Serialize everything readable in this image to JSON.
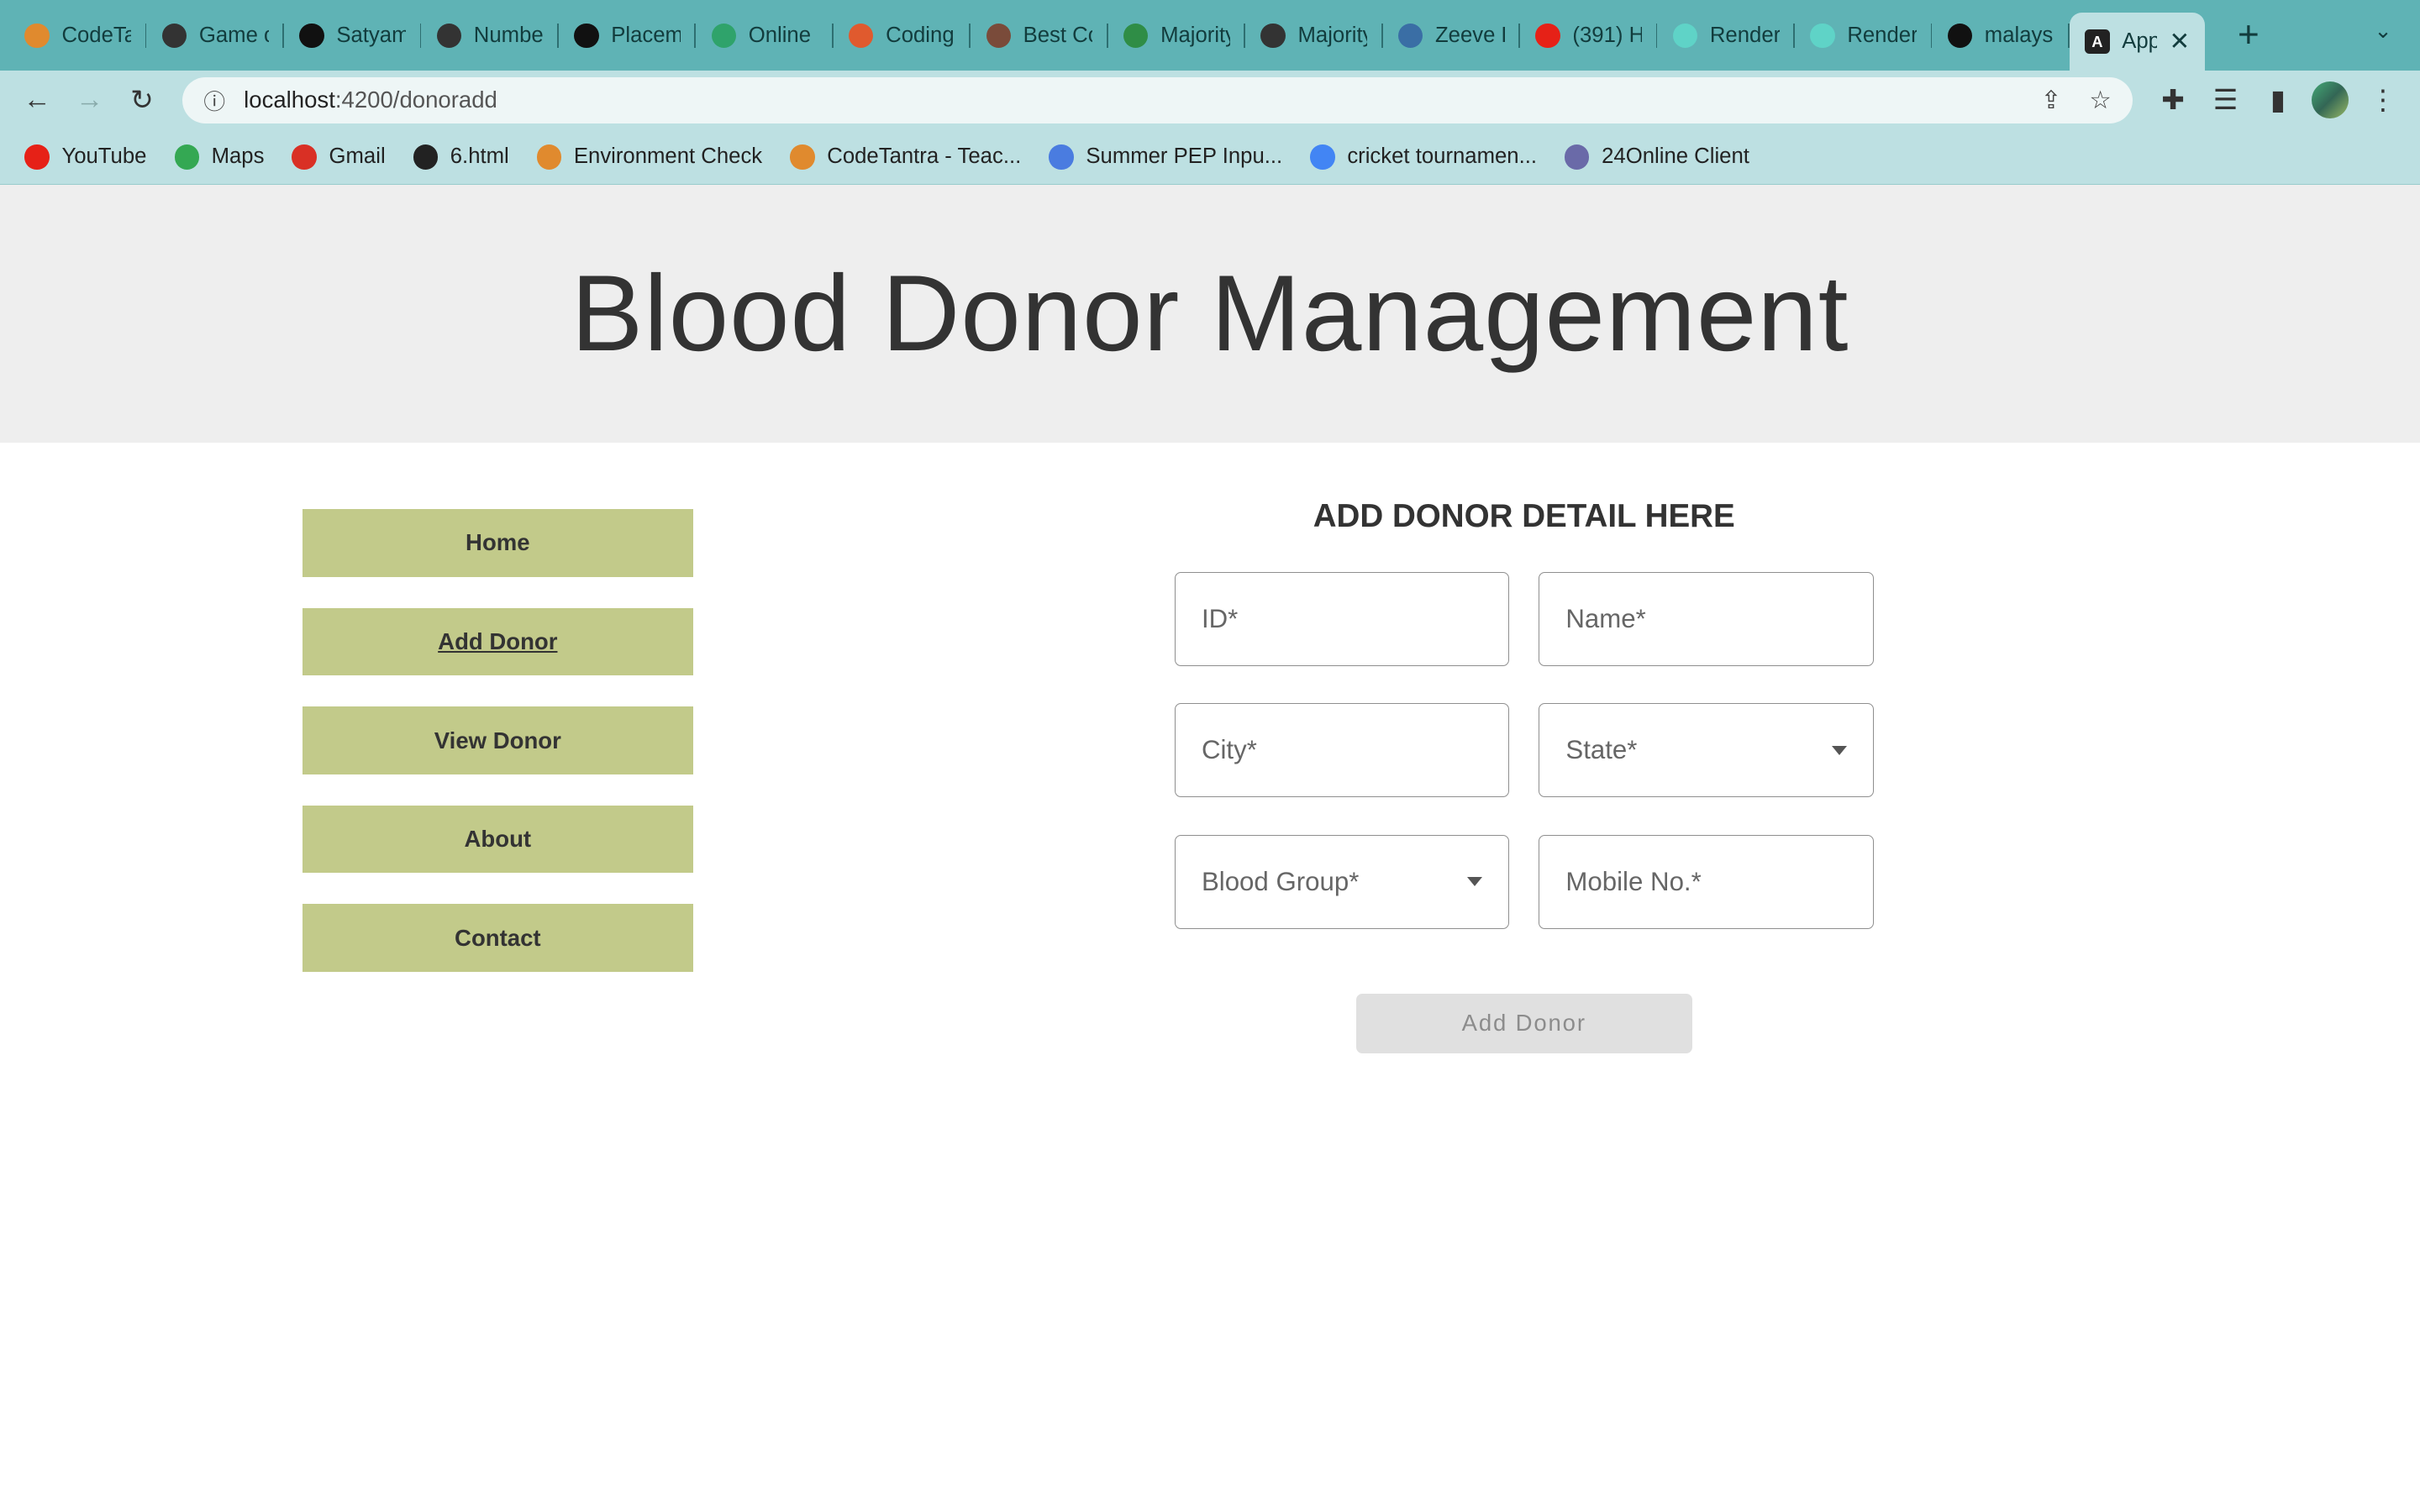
{
  "browser": {
    "tabs": [
      {
        "label": "CodeTa",
        "icon": "codetantra-icon",
        "color": "#e08a2e"
      },
      {
        "label": "Game o",
        "icon": "geeks-icon",
        "color": "#333333"
      },
      {
        "label": "Satyam",
        "icon": "github-icon",
        "color": "#111111"
      },
      {
        "label": "Numbe",
        "icon": "geeks-icon",
        "color": "#333333"
      },
      {
        "label": "Placem",
        "icon": "globe-icon",
        "color": "#111111"
      },
      {
        "label": "Online",
        "icon": "vue-icon",
        "color": "#2fa36b"
      },
      {
        "label": "Coding",
        "icon": "coding-icon",
        "color": "#e05a2e"
      },
      {
        "label": "Best Co",
        "icon": "avatar-icon",
        "color": "#7a4b3a"
      },
      {
        "label": "Majority",
        "icon": "gfg-icon",
        "color": "#2f8d46"
      },
      {
        "label": "Majority",
        "icon": "geeks-icon",
        "color": "#333333"
      },
      {
        "label": "Zeeve F",
        "icon": "zeeve-icon",
        "color": "#3a6ea5"
      },
      {
        "label": "(391) H",
        "icon": "youtube-icon",
        "color": "#e62117"
      },
      {
        "label": "Render",
        "icon": "render-icon",
        "color": "#5fd3c7"
      },
      {
        "label": "Render",
        "icon": "render-icon",
        "color": "#5fd3c7"
      },
      {
        "label": "malays",
        "icon": "github-icon",
        "color": "#111111"
      }
    ],
    "active_tab": {
      "label": "App",
      "icon": "angular-icon"
    },
    "url_host": "localhost",
    "url_path": ":4200/donoradd",
    "bookmarks": [
      {
        "label": "YouTube",
        "icon": "youtube-icon",
        "color": "#e62117"
      },
      {
        "label": "Maps",
        "icon": "maps-icon",
        "color": "#34a853"
      },
      {
        "label": "Gmail",
        "icon": "gmail-icon",
        "color": "#d93025"
      },
      {
        "label": "6.html",
        "icon": "globe-icon",
        "color": "#222222"
      },
      {
        "label": "Environment Check",
        "icon": "codetantra-icon",
        "color": "#e08a2e"
      },
      {
        "label": "CodeTantra - Teac...",
        "icon": "codetantra-icon",
        "color": "#e08a2e"
      },
      {
        "label": "Summer PEP Inpu...",
        "icon": "docs-icon",
        "color": "#4a7ce0"
      },
      {
        "label": "cricket tournamen...",
        "icon": "google-icon",
        "color": "#4285f4"
      },
      {
        "label": "24Online Client",
        "icon": "24online-icon",
        "color": "#6a6aa8"
      }
    ]
  },
  "header": {
    "title": "Blood Donor Management"
  },
  "nav": {
    "items": [
      "Home",
      "Add Donor",
      "View Donor",
      "About",
      "Contact"
    ],
    "active": "Add Donor"
  },
  "form": {
    "title": "ADD DONOR DETAIL HERE",
    "fields": {
      "id": "ID*",
      "name": "Name*",
      "city": "City*",
      "state": "State*",
      "blood_group": "Blood Group*",
      "mobile": "Mobile No.*"
    },
    "submit_label": "Add Donor"
  }
}
